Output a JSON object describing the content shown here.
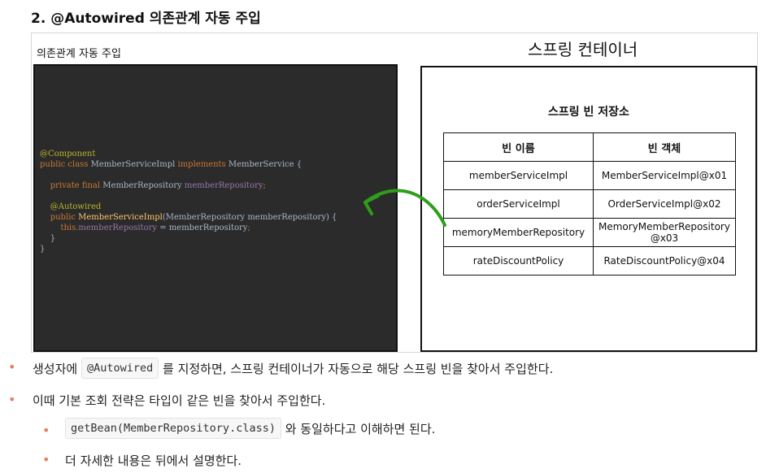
{
  "heading": "2. @Autowired 의존관계 자동 주입",
  "slide": {
    "caption": "의존관계 자동 주입",
    "container_title": "스프링 컨테이너",
    "store_title": "스프링 빈 저장소",
    "code": {
      "line1": "@Component",
      "line2_kw1": "public class ",
      "line2_name": "MemberServiceImpl ",
      "line2_kw2": "implements ",
      "line2_iface": "MemberService {",
      "line3_kw": "private final ",
      "line3_type": "MemberRepository ",
      "line3_field": "memberRepository",
      "line3_end": ";",
      "line4": "@Autowired",
      "line5_kw": "public ",
      "line5_fn": "MemberServiceImpl",
      "line5_args": "(MemberRepository memberRepository) {",
      "line6_kw": "this.",
      "line6_field": "memberRepository",
      "line6_rest": " = memberRepository",
      "line6_end": ";",
      "line7": "}",
      "line8": "}"
    },
    "table": {
      "headers": [
        "빈 이름",
        "빈 객체"
      ],
      "rows": [
        [
          "memberServiceImpl",
          "MemberServiceImpl@x01"
        ],
        [
          "orderServiceImpl",
          "OrderServiceImpl@x02"
        ],
        [
          "memoryMemberRepository",
          "MemoryMemberRepository @x03"
        ],
        [
          "rateDiscountPolicy",
          "RateDiscountPolicy@x04"
        ]
      ]
    },
    "colors": {
      "arrow": "#2e9e1a",
      "code_bg": "#2b2b2b",
      "bullet": "#e67e5e"
    }
  },
  "bullets": [
    {
      "before": "생성자에 ",
      "code": "@Autowired",
      "after": " 를 지정하면, 스프링 컨테이너가 자동으로 해당 스프링 빈을 찾아서 주입한다."
    },
    {
      "text": "이때 기본 조회 전략은 타입이 같은 빈을 찾아서 주입한다."
    },
    {
      "code": "getBean(MemberRepository.class)",
      "after": " 와 동일하다고 이해하면 된다."
    },
    {
      "text": "더 자세한 내용은 뒤에서 설명한다."
    }
  ]
}
